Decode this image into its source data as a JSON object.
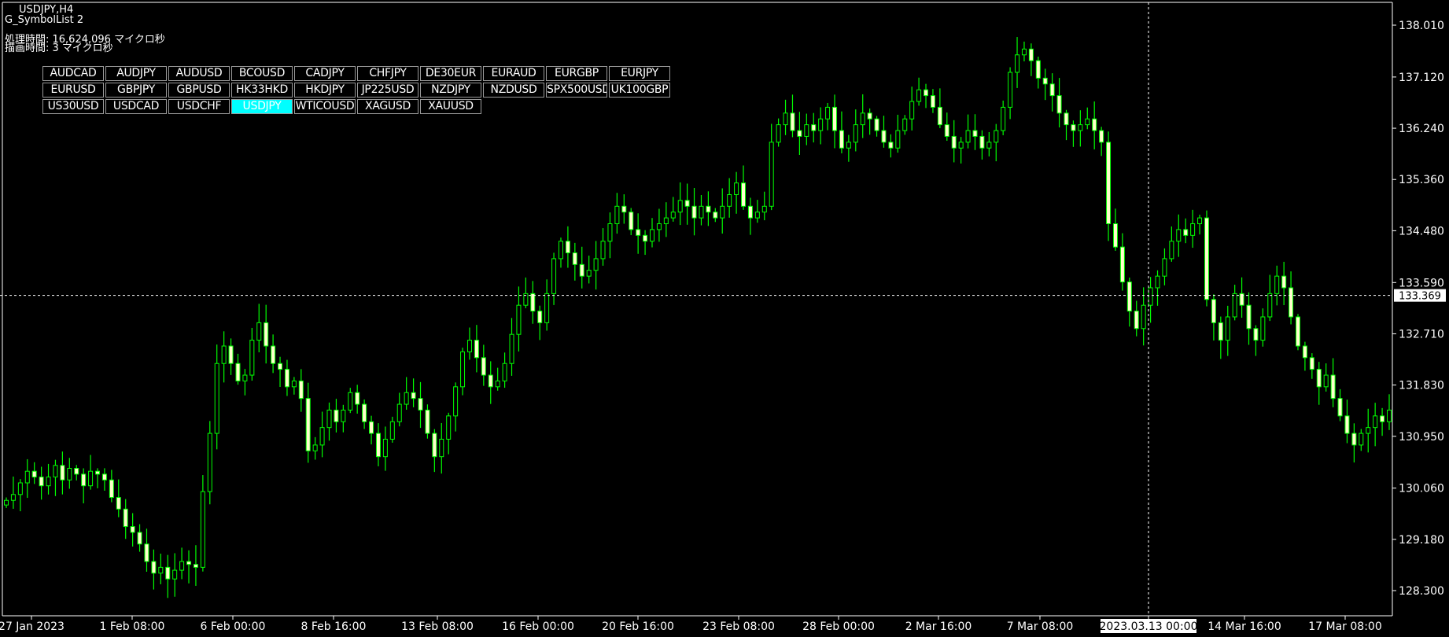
{
  "window": {
    "title": "USDJPY,H4",
    "indicator_name": "G_SymbolList 2",
    "processing_time": "処理時間: 16,624,096 マイクロ秒",
    "drawing_time": "描画時間: 3 マイクロ秒"
  },
  "symbols": [
    {
      "label": "AUDCAD",
      "active": false
    },
    {
      "label": "AUDJPY",
      "active": false
    },
    {
      "label": "AUDUSD",
      "active": false
    },
    {
      "label": "BCOUSD",
      "active": false
    },
    {
      "label": "CADJPY",
      "active": false
    },
    {
      "label": "CHFJPY",
      "active": false
    },
    {
      "label": "DE30EUR",
      "active": false
    },
    {
      "label": "EURAUD",
      "active": false
    },
    {
      "label": "EURGBP",
      "active": false
    },
    {
      "label": "EURJPY",
      "active": false
    },
    {
      "label": "EURUSD",
      "active": false
    },
    {
      "label": "GBPJPY",
      "active": false
    },
    {
      "label": "GBPUSD",
      "active": false
    },
    {
      "label": "HK33HKD",
      "active": false
    },
    {
      "label": "HKDJPY",
      "active": false
    },
    {
      "label": "JP225USD",
      "active": false
    },
    {
      "label": "NZDJPY",
      "active": false
    },
    {
      "label": "NZDUSD",
      "active": false
    },
    {
      "label": "SPX500USD",
      "active": false
    },
    {
      "label": "UK100GBP",
      "active": false
    },
    {
      "label": "US30USD",
      "active": false
    },
    {
      "label": "USDCAD",
      "active": false
    },
    {
      "label": "USDCHF",
      "active": false
    },
    {
      "label": "USDJPY",
      "active": true
    },
    {
      "label": "WTICOUSD",
      "active": false
    },
    {
      "label": "XAGUSD",
      "active": false
    },
    {
      "label": "XAUUSD",
      "active": false
    }
  ],
  "colors": {
    "background": "#000000",
    "axis": "#ffffff",
    "candle_bull_body": "#000000",
    "candle_bear_body": "#ffffcc",
    "wick": "#00ff00",
    "active_symbol": "#00ffff",
    "crosshair": "#ffffff"
  },
  "chart_data": {
    "type": "candlestick",
    "symbol": "USDJPY",
    "timeframe": "H4",
    "ylim": [
      127.7,
      138.4
    ],
    "y_ticks": [
      "138.010",
      "137.120",
      "136.240",
      "135.360",
      "134.480",
      "133.590",
      "132.710",
      "131.830",
      "130.950",
      "130.060",
      "129.180",
      "128.300"
    ],
    "x_ticks": [
      "27 Jan 2023",
      "1 Feb 08:00",
      "6 Feb 00:00",
      "8 Feb 16:00",
      "13 Feb 08:00",
      "16 Feb 00:00",
      "20 Feb 16:00",
      "23 Feb 08:00",
      "28 Feb 00:00",
      "2 Mar 16:00",
      "7 Mar 08:00",
      "2023.03.13 00:00",
      "14 Mar 16:00",
      "17 Mar 08:00"
    ],
    "crosshair": {
      "price": "133.369",
      "time": "2023.03.13 00:00"
    },
    "closes": [
      129.85,
      129.95,
      130.15,
      130.35,
      130.25,
      130.1,
      130.25,
      130.45,
      130.2,
      130.4,
      130.3,
      130.1,
      130.35,
      130.3,
      130.2,
      129.9,
      129.7,
      129.4,
      129.3,
      129.1,
      128.8,
      128.6,
      128.7,
      128.5,
      128.65,
      128.8,
      128.75,
      128.7,
      130.0,
      131.0,
      132.2,
      132.5,
      132.2,
      131.9,
      132.0,
      132.6,
      132.9,
      132.5,
      132.2,
      132.1,
      131.8,
      131.9,
      131.6,
      130.7,
      130.8,
      131.1,
      131.4,
      131.2,
      131.4,
      131.7,
      131.5,
      131.2,
      131.0,
      130.6,
      130.9,
      131.2,
      131.5,
      131.7,
      131.6,
      131.4,
      131.0,
      130.6,
      130.9,
      131.3,
      131.8,
      132.4,
      132.6,
      132.3,
      132.0,
      131.8,
      131.9,
      132.2,
      132.7,
      133.2,
      133.4,
      133.1,
      132.9,
      133.4,
      134.0,
      134.3,
      134.1,
      133.9,
      133.7,
      133.8,
      134.0,
      134.3,
      134.6,
      134.9,
      134.8,
      134.5,
      134.4,
      134.3,
      134.5,
      134.6,
      134.7,
      134.8,
      135.0,
      134.9,
      134.7,
      134.9,
      134.8,
      134.7,
      134.9,
      135.1,
      135.3,
      134.9,
      134.7,
      134.8,
      134.9,
      136.0,
      136.3,
      136.5,
      136.2,
      136.1,
      136.3,
      136.2,
      136.4,
      136.6,
      136.2,
      135.9,
      136.0,
      136.3,
      136.5,
      136.4,
      136.2,
      136.0,
      135.9,
      136.2,
      136.4,
      136.7,
      136.9,
      136.8,
      136.6,
      136.3,
      136.1,
      135.9,
      136.0,
      136.2,
      136.1,
      135.9,
      136.0,
      136.2,
      136.6,
      137.2,
      137.5,
      137.6,
      137.4,
      137.1,
      137.0,
      136.8,
      136.5,
      136.3,
      136.2,
      136.3,
      136.4,
      136.2,
      136.0,
      134.6,
      134.2,
      133.6,
      133.1,
      132.8,
      133.2,
      133.5,
      133.7,
      134.0,
      134.3,
      134.5,
      134.4,
      134.6,
      134.7,
      133.3,
      132.9,
      132.6,
      133.0,
      133.4,
      133.2,
      132.8,
      132.6,
      133.0,
      133.4,
      133.7,
      133.5,
      133.0,
      132.5,
      132.3,
      132.1,
      131.8,
      132.0,
      131.6,
      131.3,
      131.0,
      130.8,
      131.0,
      131.1,
      131.3,
      131.2,
      131.4
    ]
  }
}
